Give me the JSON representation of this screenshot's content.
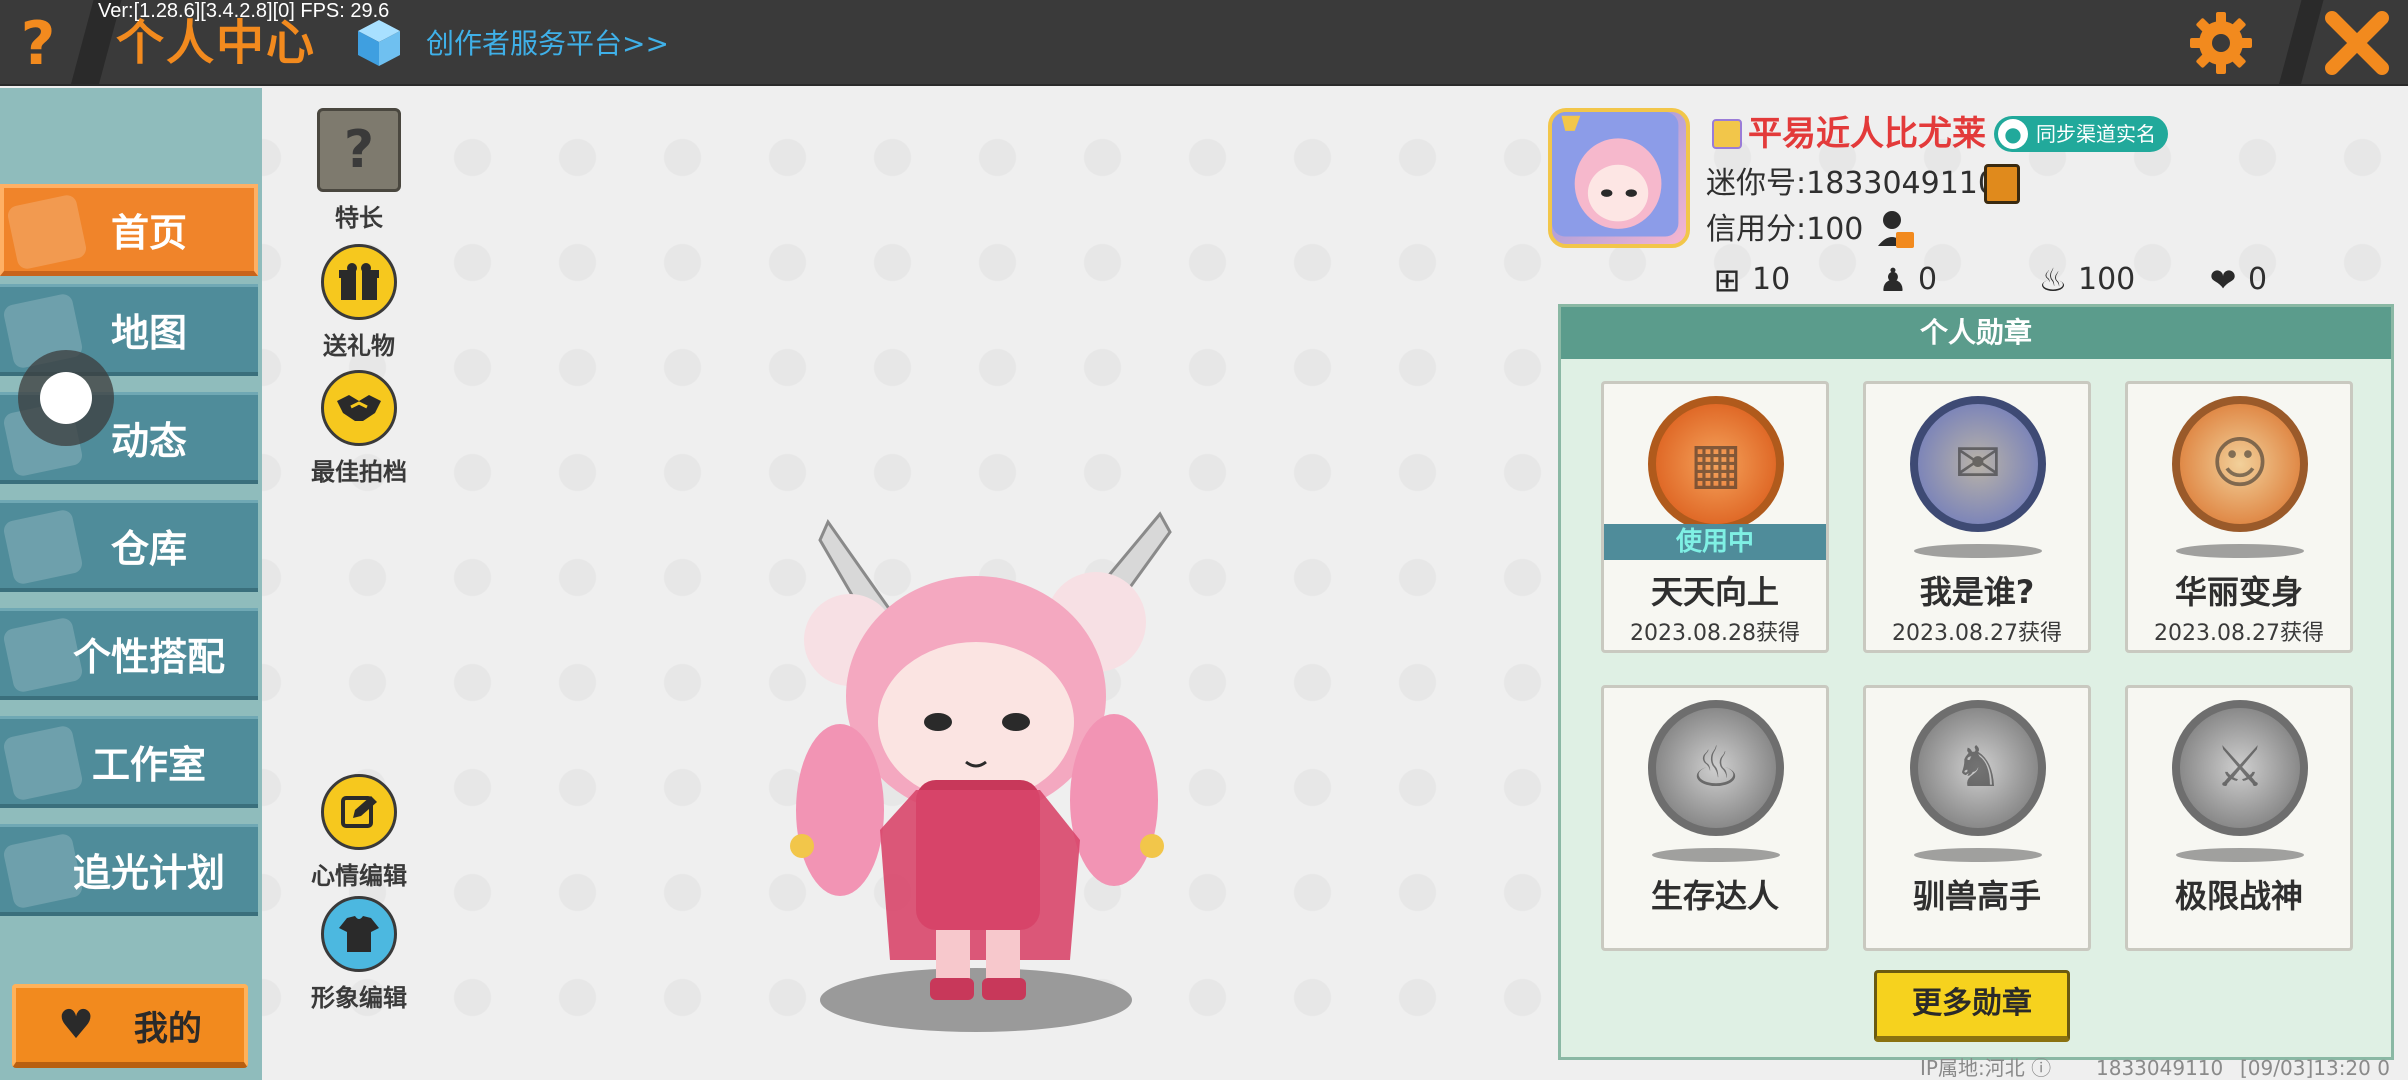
{
  "topbar": {
    "help_glyph": "?",
    "title": "个人中心",
    "version": "Ver:[1.28.6][3.4.2.8][0] FPS: 29.6",
    "creator_link": "创作者服务平台>>"
  },
  "sidebar": {
    "items": [
      {
        "label": "首页",
        "active": true
      },
      {
        "label": "地图",
        "active": false
      },
      {
        "label": "动态",
        "active": false
      },
      {
        "label": "仓库",
        "active": false
      },
      {
        "label": "个性搭配",
        "active": false
      },
      {
        "label": "工作室",
        "active": false
      },
      {
        "label": "追光计划",
        "active": false
      }
    ],
    "mine_label": "我的"
  },
  "actions": {
    "specialty": {
      "label": "特长",
      "glyph": "?"
    },
    "gift": {
      "label": "送礼物"
    },
    "best_partner": {
      "label": "最佳拍档"
    },
    "mood_edit": {
      "label": "心情编辑"
    },
    "image_edit": {
      "label": "形象编辑"
    }
  },
  "profile": {
    "name": "平易近人比尤莱",
    "sync_label": "同步渠道实名",
    "mini_id": "迷你号:1833049110",
    "credit": "信用分:100",
    "stats": {
      "follow": "10",
      "fans": "0",
      "popularity": "100",
      "likes": "0"
    }
  },
  "medals": {
    "title": "个人勋章",
    "items": [
      {
        "name": "天天向上",
        "date": "2023.08.28获得",
        "in_use": "使用中"
      },
      {
        "name": "我是谁?",
        "date": "2023.08.27获得"
      },
      {
        "name": "华丽变身",
        "date": "2023.08.27获得"
      },
      {
        "name": "生存达人",
        "date": ""
      },
      {
        "name": "驯兽高手",
        "date": ""
      },
      {
        "name": "极限战神",
        "date": ""
      }
    ],
    "more_label": "更多勋章"
  },
  "footer": {
    "ip": "IP属地:河北",
    "uid": "1833049110",
    "time": "[09/03]13:20 0"
  },
  "colors": {
    "accent_orange": "#f28a1e",
    "sidebar_teal": "#4f8c9a",
    "name_red": "#e33a3a",
    "medal_header": "#5b9c8c",
    "button_yellow": "#f6d21e"
  }
}
